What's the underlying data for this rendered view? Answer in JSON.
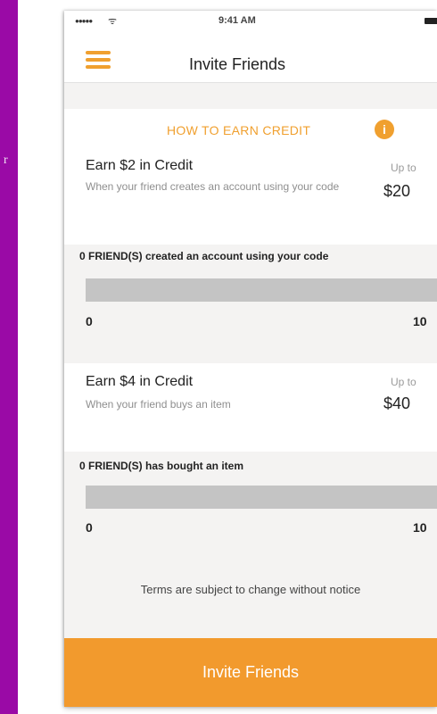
{
  "statusbar": {
    "clock": "9:41 AM",
    "signal_dots": "●●●●●",
    "wifi": "ᯤ"
  },
  "nav": {
    "title": "Invite Friends"
  },
  "howto": {
    "label": "HOW TO EARN CREDIT",
    "info_glyph": "i"
  },
  "cards": [
    {
      "title": "Earn $2 in Credit",
      "description": "When your friend creates an account using your code",
      "upto_label": "Up to",
      "amount": "$20",
      "progress_label": "0 FRIEND(S) created an account using your code",
      "progress_min": "0",
      "progress_max": "10",
      "progress_value": 0
    },
    {
      "title": "Earn $4 in Credit",
      "description": "When your friend buys an item",
      "upto_label": "Up to",
      "amount": "$40",
      "progress_label": "0 FRIEND(S) has bought an item",
      "progress_min": "0",
      "progress_max": "10",
      "progress_value": 0
    }
  ],
  "terms": "Terms are subject to change without notice",
  "footer": {
    "button_label": "Invite Friends"
  },
  "strip": {
    "glyph": "r"
  },
  "colors": {
    "accent": "#f0a02f",
    "bar_track": "#c4c4c4",
    "background_strip": "#9a0aa6"
  }
}
